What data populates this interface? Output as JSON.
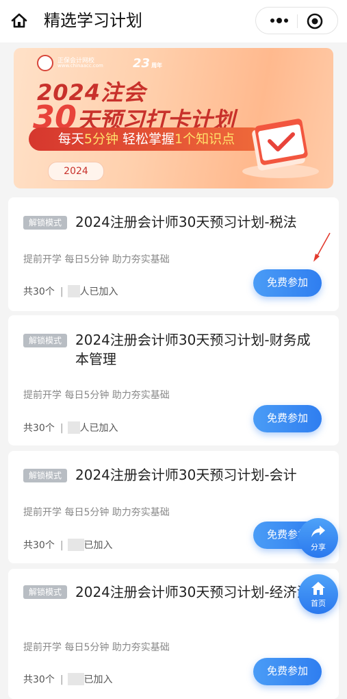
{
  "header": {
    "title": "精选学习计划",
    "home_icon": "home-icon",
    "more_icon": "more-dots-icon",
    "close_icon": "target-circle-icon"
  },
  "banner": {
    "brand": "正保会计网校",
    "brand_url": "www.chinaacc.com",
    "anniversary": "23",
    "anniversary_suffix": "周年",
    "line1": "2024注会",
    "line2_num": "30",
    "line2_text": "天预习打卡计划",
    "pill_a": "每天",
    "pill_b": "5分钟",
    "pill_c": " 轻松掌握",
    "pill_d": "1个知识点",
    "year_tag": "2024"
  },
  "cards": [
    {
      "badge": "解锁模式",
      "title": "2024注册会计师30天预习计划-税法",
      "subtitle": "提前开学 每日5分钟 助力夯实基础",
      "count": "共30个",
      "sep": "|",
      "joined_suffix": "人已加入",
      "button": "免费参加"
    },
    {
      "badge": "解锁模式",
      "title": "2024注册会计师30天预习计划-财务成本管理",
      "subtitle": "提前开学 每日5分钟 助力夯实基础",
      "count": "共30个",
      "sep": "|",
      "joined_suffix": "人已加入",
      "button": "免费参加"
    },
    {
      "badge": "解锁模式",
      "title": "2024注册会计师30天预习计划-会计",
      "subtitle": "提前开学 每日5分钟 助力夯实基础",
      "count": "共30个",
      "sep": "|",
      "joined_suffix": "已加入",
      "button": "免费参加"
    },
    {
      "badge": "解锁模式",
      "title": "2024注册会计师30天预习计划-经济法",
      "subtitle": "提前开学 每日5分钟 助力夯实基础",
      "count": "共30个",
      "sep": "|",
      "joined_suffix": "已加入",
      "button": "免费参加"
    }
  ],
  "fabs": {
    "share_label": "分享",
    "share_icon": "share-arrow-icon",
    "home_label": "首页",
    "home_icon": "home-icon"
  },
  "colors": {
    "accent_blue": "#2f7ef0",
    "banner_red": "#c8312b",
    "badge_gray": "#b8bdc3"
  }
}
